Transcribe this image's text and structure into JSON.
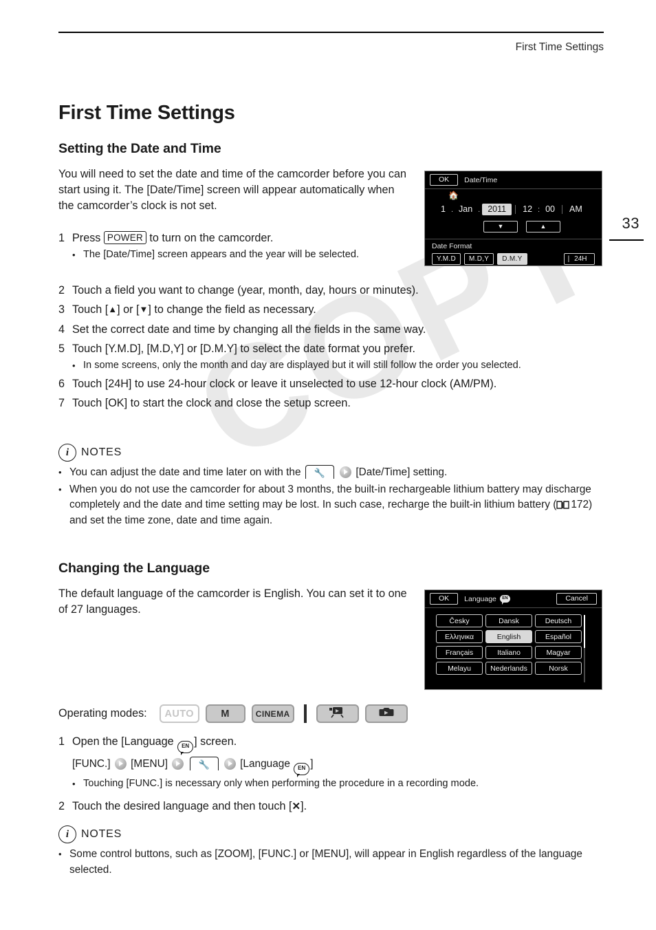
{
  "running_head": "First Time Settings",
  "page_number": "33",
  "chapter_title": "First Time Settings",
  "section_datetime": {
    "heading": "Setting the Date and Time",
    "intro": "You will need to set the date and time of the camcorder before you can start using it. The [Date/Time] screen will appear automatically when the camcorder’s clock is not set.",
    "steps": [
      {
        "num": "1",
        "text_before": "Press",
        "keycap": "POWER",
        "text_after": "to turn on the camcorder.",
        "bullets": [
          "The [Date/Time] screen appears and the year will be selected."
        ]
      },
      {
        "num": "2",
        "text": "Touch a field you want to change (year, month, day, hours or minutes).",
        "bullets": []
      },
      {
        "num": "3",
        "text_before": "Touch [",
        "up_glyph": "▲",
        "text_mid": "] or [",
        "down_glyph": "▼",
        "text_after": "] to change the field as necessary.",
        "bullets": []
      },
      {
        "num": "4",
        "text": "Set the correct date and time by changing all the fields in the same way.",
        "bullets": []
      },
      {
        "num": "5",
        "text": "Touch [Y.M.D], [M.D,Y] or [D.M.Y] to select the date format you prefer.",
        "bullets": [
          "In some screens, only the month and day are displayed but it will still follow the order you selected."
        ]
      },
      {
        "num": "6",
        "text": "Touch [24H] to use 24-hour clock or leave it unselected to use 12-hour clock (AM/PM).",
        "bullets": []
      },
      {
        "num": "7",
        "text": "Touch [OK] to start the clock and close the setup screen.",
        "bullets": []
      }
    ],
    "notes_label": "NOTES",
    "notes": {
      "note1_before": "You can adjust the date and time later on with the",
      "note1_after": "[Date/Time] setting.",
      "note2_before": "When you do not use the camcorder for about 3 months, the built-in rechargeable lithium battery may discharge completely and the date and time setting may be lost. In such case, recharge the built-in lithium battery (",
      "note2_page": "172",
      "note2_after": ") and set the time zone, date and time again."
    }
  },
  "section_language": {
    "heading": "Changing the Language",
    "intro": "The default language of the camcorder is English. You can set it to one of 27 languages.",
    "operating_modes_label": "Operating modes:",
    "modes": [
      {
        "label": "AUTO",
        "state": "off"
      },
      {
        "label": "M",
        "state": "on"
      },
      {
        "label": "CINEMA",
        "state": "on-small"
      }
    ],
    "playback_modes": [
      {
        "icon": "movie-playback-icon"
      },
      {
        "icon": "photo-playback-icon"
      }
    ],
    "steps": [
      {
        "num": "1",
        "text_before": "Open the [Language",
        "text_after": "] screen.",
        "path": {
          "func": "[FUNC.]",
          "menu": "[MENU]",
          "language": "[Language"
        },
        "bullets": [
          "Touching [FUNC.] is necessary only when performing the procedure in a recording mode."
        ]
      },
      {
        "num": "2",
        "text_before": "Touch the desired language and then touch [",
        "x_glyph": "✕",
        "text_after": "].",
        "bullets": []
      }
    ],
    "notes_label": "NOTES",
    "notes": {
      "note1": "Some control buttons, such as [ZOOM], [FUNC.] or [MENU], will appear in English regardless of the language selected."
    }
  },
  "lcd_datetime": {
    "ok_label": "OK",
    "title": "Date/Time",
    "home_icon": "home-icon",
    "day": "1",
    "sep1": ".",
    "month": "Jan",
    "sep2": ".",
    "year": "2011",
    "hour": "12",
    "colon": ":",
    "minute": "00",
    "meridiem": "AM",
    "down_arrow": "▼",
    "up_arrow": "▲",
    "format_label": "Date Format",
    "formats": [
      {
        "label": "Y.M.D",
        "selected": false
      },
      {
        "label": "M.D,Y",
        "selected": false
      },
      {
        "label": "D.M.Y",
        "selected": true
      }
    ],
    "clock_24h": "24H"
  },
  "lcd_language": {
    "ok_label": "OK",
    "title": "Language",
    "title_icon_text": "EN",
    "cancel_label": "Cancel",
    "rows": [
      [
        {
          "label": "Česky",
          "selected": false
        },
        {
          "label": "Dansk",
          "selected": false
        },
        {
          "label": "Deutsch",
          "selected": false
        }
      ],
      [
        {
          "label": "Ελληνικα",
          "selected": false
        },
        {
          "label": "English",
          "selected": true
        },
        {
          "label": "Español",
          "selected": false
        }
      ],
      [
        {
          "label": "Français",
          "selected": false
        },
        {
          "label": "Italiano",
          "selected": false
        },
        {
          "label": "Magyar",
          "selected": false
        }
      ],
      [
        {
          "label": "Melayu",
          "selected": false
        },
        {
          "label": "Nederlands",
          "selected": false
        },
        {
          "label": "Norsk",
          "selected": false
        }
      ]
    ]
  },
  "watermark": "COPY"
}
